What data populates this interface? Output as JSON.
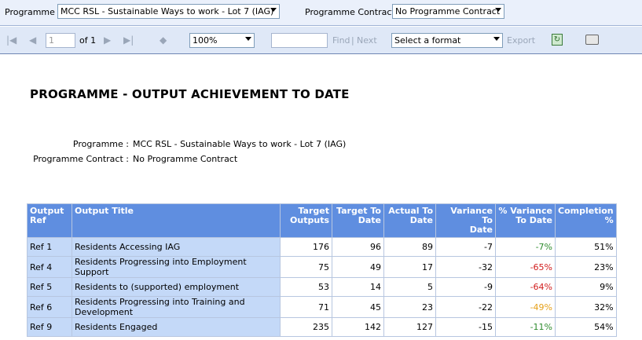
{
  "params": {
    "programme_label": "Programme",
    "programme_value": "MCC RSL - Sustainable Ways to work - Lot 7 (IAG)",
    "contract_label": "Programme Contract",
    "contract_value": "No Programme Contract"
  },
  "toolbar": {
    "first_icon": "first-page-icon",
    "prev_icon": "previous-page-icon",
    "page_number": "1",
    "of_label": "of 1",
    "next_icon": "next-page-icon",
    "last_icon": "last-page-icon",
    "back_icon": "back-icon",
    "zoom": "100%",
    "find_label": "Find",
    "separator": "|",
    "next_label": "Next",
    "format_value": "Select a format",
    "export_label": "Export",
    "refresh_icon": "refresh-icon",
    "print_icon": "print-icon"
  },
  "report": {
    "title": "PROGRAMME - OUTPUT ACHIEVEMENT TO DATE",
    "programme_label": "Programme :",
    "programme_value": "MCC RSL - Sustainable Ways to work - Lot 7 (IAG)",
    "contract_label": "Programme Contract :",
    "contract_value": "No Programme Contract"
  },
  "table": {
    "headers": {
      "ref": [
        "Output",
        "Ref"
      ],
      "title": "Output Title",
      "target": [
        "Target",
        "Outputs"
      ],
      "target_to_date": [
        "Target To",
        "Date"
      ],
      "actual": [
        "Actual To",
        "Date"
      ],
      "variance": [
        "Variance To",
        "Date"
      ],
      "pct_variance": [
        "% Variance",
        "To Date"
      ],
      "completion": [
        "Completion",
        "%"
      ]
    },
    "rows": [
      {
        "ref": "Ref 1",
        "title": "Residents Accessing IAG",
        "target": "176",
        "target_to_date": "96",
        "actual": "89",
        "variance": "-7",
        "pct_variance": "-7%",
        "completion": "51%"
      },
      {
        "ref": "Ref 4",
        "title": "Residents Progressing into Employment Support",
        "target": "75",
        "target_to_date": "49",
        "actual": "17",
        "variance": "-32",
        "pct_variance": "-65%",
        "completion": "23%"
      },
      {
        "ref": "Ref 5",
        "title": "Residents to (supported) employment",
        "target": "53",
        "target_to_date": "14",
        "actual": "5",
        "variance": "-9",
        "pct_variance": "-64%",
        "completion": "9%"
      },
      {
        "ref": "Ref 6",
        "title": "Residents Progressing into Training and Development",
        "target": "71",
        "target_to_date": "45",
        "actual": "23",
        "variance": "-22",
        "pct_variance": "-49%",
        "completion": "32%"
      },
      {
        "ref": "Ref 9",
        "title": "Residents Engaged",
        "target": "235",
        "target_to_date": "142",
        "actual": "127",
        "variance": "-15",
        "pct_variance": "-11%",
        "completion": "54%"
      }
    ],
    "pct_colors": [
      "#2e8b2e",
      "#d11c1c",
      "#d11c1c",
      "#e6a11a",
      "#2e8b2e"
    ]
  }
}
